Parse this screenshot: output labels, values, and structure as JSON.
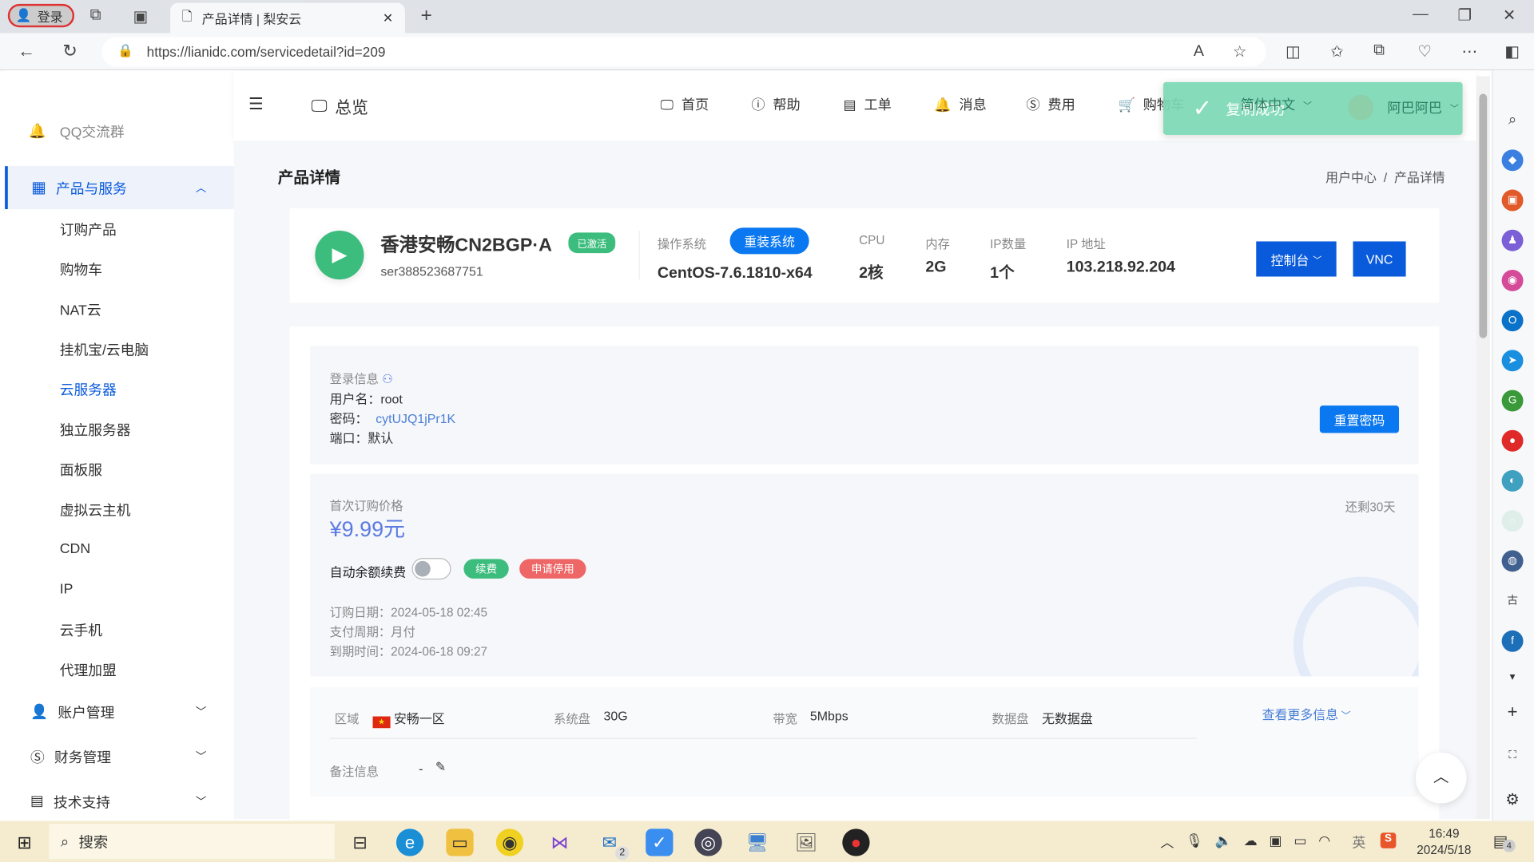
{
  "browser": {
    "login": "登录",
    "tab_title": "产品详情 | 梨安云",
    "url": "https://lianidc.com/servicedetail?id=209"
  },
  "sidebar": {
    "partial_item": "QQ交流群",
    "group": "产品与服务",
    "items": [
      "订购产品",
      "购物车",
      "NAT云",
      "挂机宝/云电脑",
      "云服务器",
      "独立服务器",
      "面板服",
      "虚拟云主机",
      "CDN",
      "IP",
      "云手机",
      "代理加盟"
    ],
    "active": "云服务器",
    "sections": [
      "账户管理",
      "财务管理",
      "技术支持"
    ]
  },
  "topnav": {
    "overview": "总览",
    "items": [
      "首页",
      "帮助",
      "工单",
      "消息",
      "费用",
      "购物车"
    ],
    "language": "简体中文",
    "user": "阿巴阿巴"
  },
  "toast": {
    "text": "复制成功",
    "color": "#7dd9b5"
  },
  "page": {
    "title": "产品详情",
    "breadcrumb": [
      "用户中心",
      "产品详情"
    ]
  },
  "product": {
    "name": "香港安畅CN2BGP·A",
    "status": "已激活",
    "id": "ser388523687751",
    "os_label": "操作系统",
    "reinstall": "重装系统",
    "os": "CentOS-7.6.1810-x64",
    "cpu_label": "CPU",
    "cpu": "2核",
    "mem_label": "内存",
    "mem": "2G",
    "ipcount_label": "IP数量",
    "ipcount": "1个",
    "ip_label": "IP 地址",
    "ip": "103.218.92.204",
    "console": "控制台",
    "vnc": "VNC"
  },
  "login": {
    "title": "登录信息",
    "username": "用户名：root",
    "password_label": "密码：",
    "password": "cytUJQ1jPr1K",
    "port": "端口：默认",
    "reset": "重置密码"
  },
  "billing": {
    "price_label": "首次订购价格",
    "price": "¥9.99元",
    "remaining": "还剩30天",
    "auto_renew": "自动余额续费",
    "auto_renew_on": false,
    "renew": "续费",
    "stop": "申请停用",
    "order_date": "订购日期：2024-05-18 02:45",
    "cycle": "支付周期：月付",
    "expire": "到期时间：2024-06-18 09:27"
  },
  "specs": {
    "region_label": "区域",
    "region": "安畅一区",
    "sysdisk_label": "系统盘",
    "sysdisk": "30G",
    "bw_label": "带宽",
    "bw": "5Mbps",
    "datadisk_label": "数据盘",
    "datadisk": "无数据盘",
    "more": "查看更多信息",
    "note_label": "备注信息",
    "note": "-"
  },
  "taskbar": {
    "search": "搜索",
    "ime": "英",
    "time": "16:49",
    "date": "2024/5/18",
    "mail_badge": "2",
    "notif_badge": "4"
  },
  "colors": {
    "primary": "#0a5bdc",
    "green": "#3dbd7d",
    "red": "#ee6666",
    "price": "#5b7be0"
  }
}
